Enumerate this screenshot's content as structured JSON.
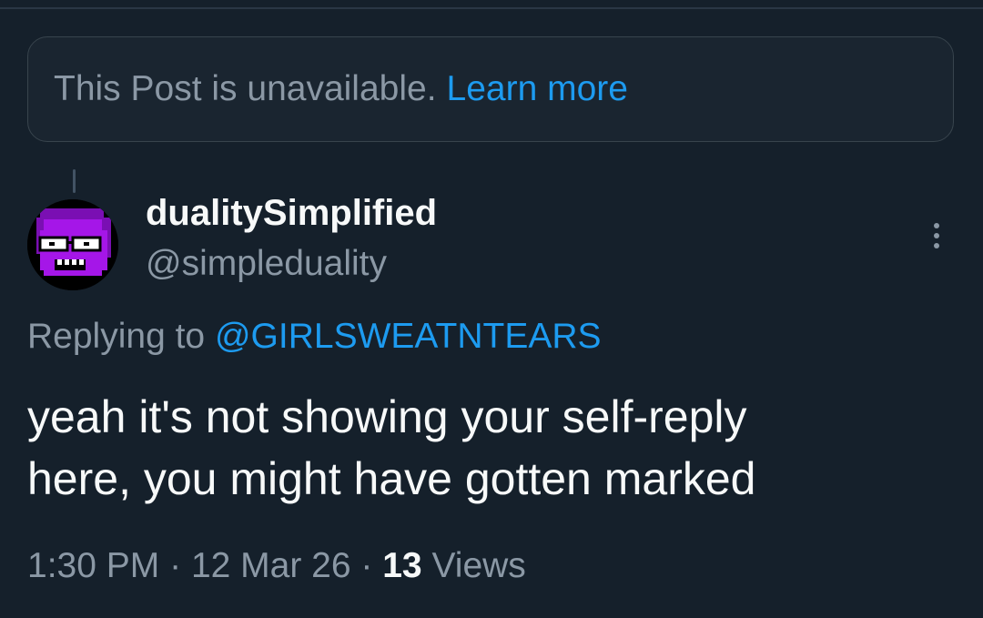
{
  "unavailable_notice": {
    "text": "This Post is unavailable.",
    "link": "Learn more"
  },
  "author": {
    "display_name": "dualitySimplified",
    "handle": "@simpleduality",
    "avatar_icon": "purple-pixel-face-avatar"
  },
  "more_icon": "more-vertical-icon",
  "reply": {
    "prefix": "Replying to",
    "mention": "@GIRLSWEATNTEARS"
  },
  "tweet": {
    "line1": "yeah it's not showing your self-reply",
    "line2": "here, you might have gotten marked"
  },
  "meta": {
    "time": "1:30 PM",
    "separator": "·",
    "date": "12 Mar 26",
    "views_count": "13",
    "views_label": "Views"
  },
  "colors": {
    "background": "#15202b",
    "accent": "#1d9bf0",
    "secondary_text": "#8b98a5",
    "primary_text": "#f7f9f9",
    "avatar_purple": "#a516e8"
  }
}
